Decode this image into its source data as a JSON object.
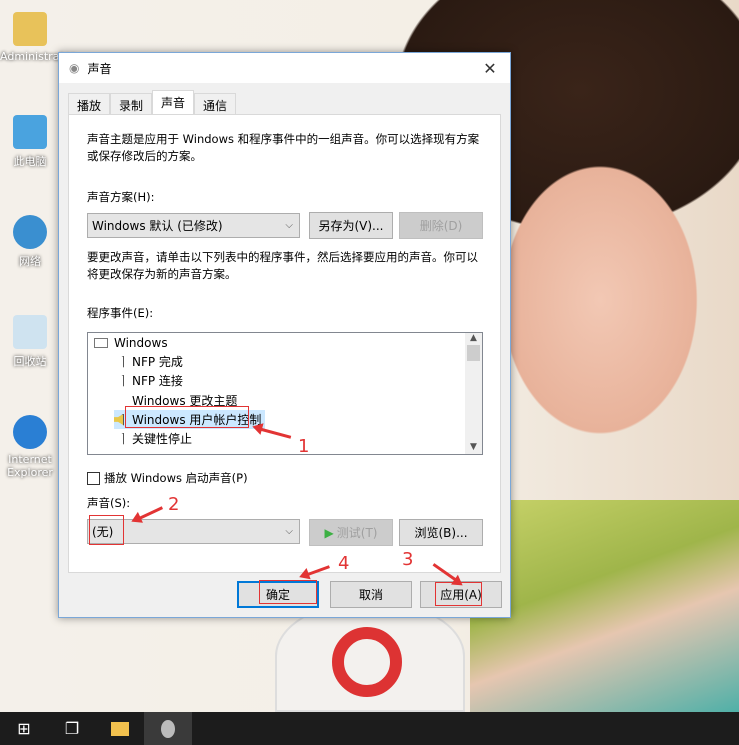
{
  "desktop": {
    "icons": [
      {
        "label": "Administrator"
      },
      {
        "label": "此电脑"
      },
      {
        "label": "网络"
      },
      {
        "label": "回收站"
      },
      {
        "label": "Internet Explorer"
      }
    ]
  },
  "dialog": {
    "title": "声音",
    "close": "✕",
    "tabs": [
      {
        "label": "播放"
      },
      {
        "label": "录制"
      },
      {
        "label": "声音"
      },
      {
        "label": "通信"
      }
    ],
    "intro": "声音主题是应用于 Windows 和程序事件中的一组声音。你可以选择现有方案或保存修改后的方案。",
    "scheme_label": "声音方案(H):",
    "scheme_value": "Windows 默认 (已修改)",
    "save_as": "另存为(V)...",
    "delete": "删除(D)",
    "instructions": "要更改声音，请单击以下列表中的程序事件，然后选择要应用的声音。你可以将更改保存为新的声音方案。",
    "events_label": "程序事件(E):",
    "events": [
      {
        "label": "Windows"
      },
      {
        "label": "NFP 完成"
      },
      {
        "label": "NFP 连接"
      },
      {
        "label": "Windows 更改主题"
      },
      {
        "label": "Windows 用户帐户控制"
      },
      {
        "label": "关键性停止"
      }
    ],
    "startup_checkbox": "播放 Windows 启动声音(P)",
    "startup_checked": false,
    "sound_label": "声音(S):",
    "sound_value": "(无)",
    "test": "测试(T)",
    "browse": "浏览(B)...",
    "ok": "确定",
    "cancel": "取消",
    "apply": "应用(A)"
  },
  "annotations": [
    "1",
    "2",
    "3",
    "4"
  ],
  "colors": {
    "accent": "#0078d7",
    "annotation": "#e23434"
  }
}
